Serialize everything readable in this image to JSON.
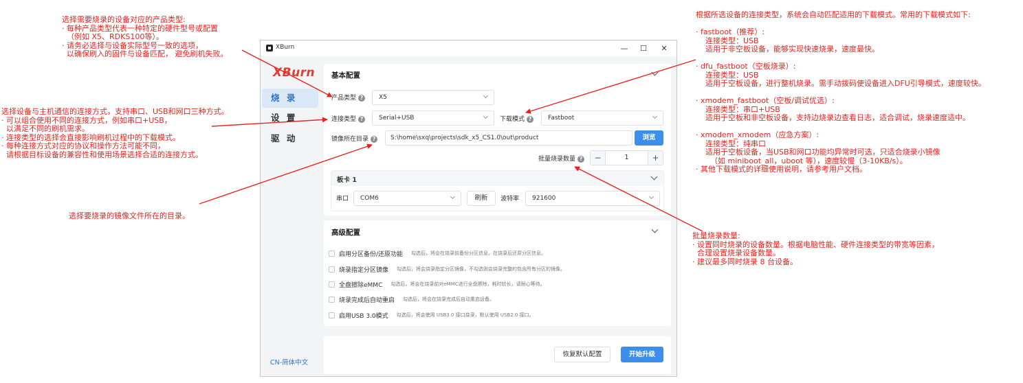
{
  "window": {
    "title": "XBurn",
    "minimize": "—",
    "maximize": "☐",
    "close": "✕"
  },
  "sidebar": {
    "logo": "XBurn",
    "items": [
      {
        "label": "烧 录",
        "active": true
      },
      {
        "label": "设 置",
        "active": false
      },
      {
        "label": "驱 动",
        "active": false
      }
    ],
    "language": "CN-简体中文"
  },
  "basic": {
    "title": "基本配置",
    "product_type": {
      "label": "产品类型",
      "value": "X5"
    },
    "connection_type": {
      "label": "连接类型",
      "value": "Serial+USB"
    },
    "download_mode": {
      "label": "下载模式",
      "value": "Fastboot"
    },
    "image_dir": {
      "label": "镜像所在目录",
      "value": "S:\\home\\sxq\\projects\\sdk_x5_CS1.0\\out\\product"
    },
    "browse_label": "浏览",
    "batch": {
      "label": "批量烧录数量",
      "value": "1",
      "minus": "−",
      "plus": "+"
    },
    "board": {
      "title": "板卡 1",
      "port_label": "串口",
      "port_value": "COM6",
      "refresh_label": "刷新",
      "baud_label": "波特率",
      "baud_value": "921600"
    }
  },
  "advanced": {
    "title": "高级配置",
    "options": [
      {
        "label": "启用分区备份/还原功能",
        "desc": "勾选后，将会在烧录前备份分区信息，在烧录后还原分区信息。",
        "checked": false
      },
      {
        "label": "烧录指定分区镜像",
        "desc": "勾选后，将会烧录指定分区镜像，不勾选则会烧录完整的包含所有分区的镜像。",
        "checked": false
      },
      {
        "label": "全盘擦除eMMC",
        "desc": "勾选后，将会在烧录前对eMMC进行全盘擦除，耗时较长，请耐心等待。",
        "checked": false
      },
      {
        "label": "烧录完成后自动重启",
        "desc": "勾选后，将会在烧录完成后自动重启设备。",
        "checked": false
      },
      {
        "label": "启用USB 3.0模式",
        "desc": "勾选后，将会使用 USB3.0 接口烧录，默认使用 USB2.0 接口。",
        "checked": false
      }
    ]
  },
  "footer": {
    "reset_label": "恢复默认配置",
    "start_label": "开始升级"
  },
  "annotations": {
    "top_left": "选择需要烧录的设备对应的产品类型:\n· 每种产品类型代表一种特定的硬件型号或配置\n  （例如 X5、RDKS100等）。\n· 请务必选择与设备实际型号一致的选项，\n  以确保刷入的固件与设备匹配， 避免刷机失败。",
    "left": "选择设备与主机通信的连接方式，支持串口、USB和网口三种方式。\n· 可以组合使用不同的连接方式，例如串口+USB，\n  以满足不同的刷机需求。\n· 连接类型的选择会直接影响刷机过程中的下载模式。\n· 每种连接方式对应的协议和操作方法可能不同，\n  请根据目标设备的兼容性和使用场景选择合适的连接方式。",
    "image_dir": "选择要烧录的镜像文件所在的目录。",
    "right": "根据所选设备的连接类型，系统会自动匹配适用的下载模式。常用的下载模式如下:\n\n· fastboot（推荐）:\n    连接类型：USB\n    适用于非空板设备，能够实现快速烧录，速度最快。\n\n· dfu_fastboot（空板烧录）:\n    连接类型：USB\n    适用于空板设备，进行整机烧录。需手动拨码使设备进入DFU引导模式，速度较快。\n\n· xmodem_fastboot（空板/调试优选）:\n    连接类型：串口+USB\n    适用于空板和非空板设备，支持边烧录边查看日志，适合调试，烧录速度适中。\n\n· xmodem_xmodem（应急方案）:\n    连接类型：纯串口\n    适用于空板设备，当USB和网口功能均异常时可选，只适合烧录小镜像\n      （如 miniboot_all，uboot 等），速度较慢（3-10KB/s）。\n· 其他下载模式的详细使用说明，请参考用户文档。",
    "batch": "批量烧录数量:\n· 设置同时烧录的设备数量。根据电脑性能、硬件连接类型的带宽等因素，\n  合理设置烧录设备数量。\n· 建议最多同时烧录 8 台设备。"
  },
  "colors": {
    "annotation": "#e8231f",
    "accent": "#3d8eea",
    "logo": "#e03b2f",
    "nav_active_bg": "#dbe8f8"
  }
}
